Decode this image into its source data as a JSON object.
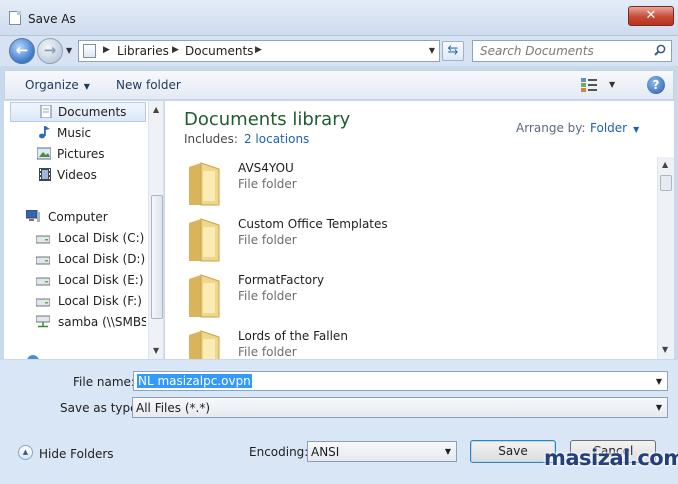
{
  "window": {
    "title": "Save As",
    "close_label": "✕"
  },
  "nav": {
    "breadcrumbs": [
      "Libraries",
      "Documents"
    ],
    "search_placeholder": "Search Documents"
  },
  "toolbar": {
    "organize_label": "Organize",
    "new_folder_label": "New folder"
  },
  "sidebar": {
    "items": [
      {
        "label": "Documents",
        "icon": "documents-icon"
      },
      {
        "label": "Music",
        "icon": "music-icon"
      },
      {
        "label": "Pictures",
        "icon": "pictures-icon"
      },
      {
        "label": "Videos",
        "icon": "videos-icon"
      },
      {
        "label": "Computer",
        "icon": "computer-icon"
      },
      {
        "label": "Local Disk (C:)",
        "icon": "drive-icon"
      },
      {
        "label": "Local Disk (D:)",
        "icon": "drive-icon"
      },
      {
        "label": "Local Disk (E:)",
        "icon": "drive-icon"
      },
      {
        "label": "Local Disk (F:)",
        "icon": "drive-icon"
      },
      {
        "label": "samba (\\\\SMBSH",
        "icon": "network-drive-icon"
      }
    ]
  },
  "library": {
    "title": "Documents library",
    "includes_label": "Includes:",
    "includes_link": "2 locations",
    "arrange_label": "Arrange by:",
    "arrange_value": "Folder"
  },
  "folders": [
    {
      "name": "AVS4YOU",
      "type": "File folder"
    },
    {
      "name": "Custom Office Templates",
      "type": "File folder"
    },
    {
      "name": "FormatFactory",
      "type": "File folder"
    },
    {
      "name": "Lords of the Fallen",
      "type": "File folder"
    }
  ],
  "form": {
    "filename_label": "File name:",
    "filename_value": "NL masizalpc.ovpn",
    "saveas_label": "Save as type:",
    "saveas_value": "All Files  (*.*)",
    "encoding_label": "Encoding:",
    "encoding_value": "ANSI",
    "save_label": "Save",
    "cancel_label": "Cancel",
    "hide_folders_label": "Hide Folders"
  },
  "watermark": "masizal.com",
  "colors": {
    "accent_blue": "#3399ff",
    "library_title": "#1e5d2f",
    "close_red": "#c74a37"
  }
}
